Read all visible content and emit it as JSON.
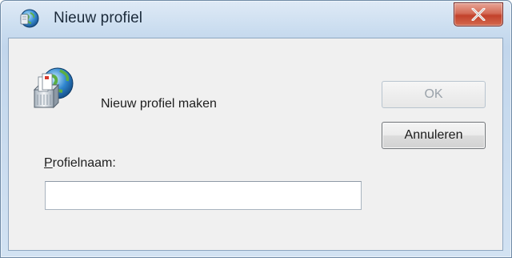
{
  "window": {
    "title": "Nieuw profiel",
    "close_icon": "close-x-icon",
    "app_icon": "mail-globe-icon"
  },
  "dialog": {
    "heading": "Nieuw profiel maken",
    "heading_icon": "mailbox-globe-icon",
    "field_label_accesskey": "P",
    "field_label_rest": "rofielnaam:",
    "field_value": "",
    "ok_label": "OK",
    "ok_enabled": false,
    "cancel_label": "Annuleren"
  },
  "colors": {
    "close_button": "#c9432d",
    "dialog_background": "#f0f0f0",
    "frame": "#c7daee"
  }
}
